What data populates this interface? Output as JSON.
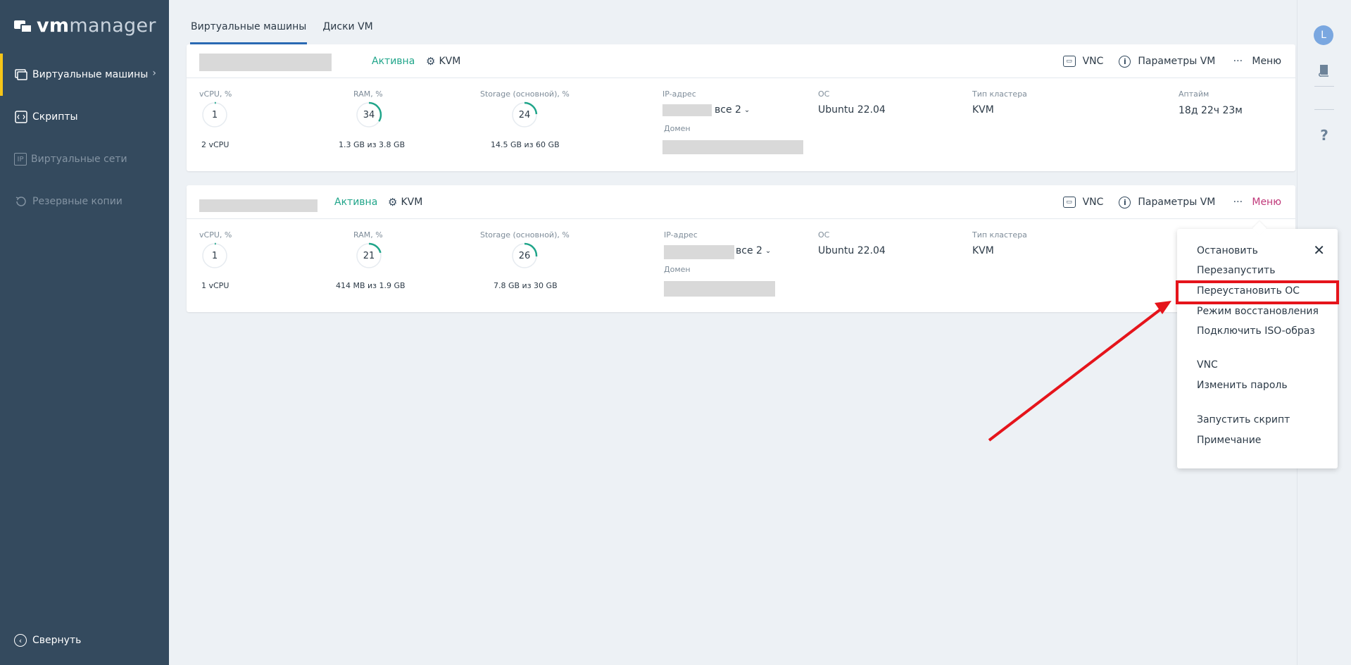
{
  "logo": {
    "vm": "vm",
    "manager": "manager"
  },
  "sidebar": {
    "items": [
      {
        "label": "Виртуальные машины",
        "icon": "vm-icon"
      },
      {
        "label": "Скрипты",
        "icon": "script-icon"
      },
      {
        "label": "Виртуальные сети",
        "icon": "ip-icon",
        "icon_text": "IP"
      },
      {
        "label": "Резервные копии",
        "icon": "backup-icon"
      }
    ],
    "collapse_label": "Свернуть"
  },
  "rail": {
    "avatar_letter": "L",
    "help": "?"
  },
  "tabs": [
    {
      "label": "Виртуальные машины",
      "active": true
    },
    {
      "label": "Диски VM",
      "active": false
    }
  ],
  "common": {
    "status": "Активна",
    "hypervisor": "KVM",
    "vnc": "VNC",
    "params": "Параметры VM",
    "menu": "Меню",
    "labels": {
      "vcpu": "vCPU, %",
      "ram": "RAM, %",
      "storage": "Storage (основной), %",
      "ip": "IP-адрес",
      "domain": "Домен",
      "os": "ОС",
      "cluster": "Тип кластера",
      "uptime": "Аптайм"
    }
  },
  "vms": [
    {
      "vcpu_pct": "1",
      "vcpu_sub": "2 vCPU",
      "ram_pct": "34",
      "ram_sub": "1.3 GB из 3.8 GB",
      "storage_pct": "24",
      "storage_sub": "14.5 GB из 60 GB",
      "ip_more": "все 2",
      "os": "Ubuntu 22.04",
      "cluster": "KVM",
      "uptime": "18д 22ч 23м"
    },
    {
      "vcpu_pct": "1",
      "vcpu_sub": "1 vCPU",
      "ram_pct": "21",
      "ram_sub": "414 MB из 1.9 GB",
      "storage_pct": "26",
      "storage_sub": "7.8 GB из 30 GB",
      "ip_more": "все 2",
      "os": "Ubuntu 22.04",
      "cluster": "KVM"
    }
  ],
  "menu": {
    "items": [
      "Остановить",
      "Перезапустить",
      "Переустановить ОС",
      "Режим восстановления",
      "Подключить ISO-образ",
      "VNC",
      "Изменить пароль",
      "Запустить скрипт",
      "Примечание"
    ],
    "highlighted": "Переустановить ОС"
  },
  "colors": {
    "sidebar": "#344a5e",
    "accent": "#20a58a",
    "active_tab": "#2a6ab3",
    "menu_open": "#c0397a",
    "annotation": "#e5141b"
  }
}
